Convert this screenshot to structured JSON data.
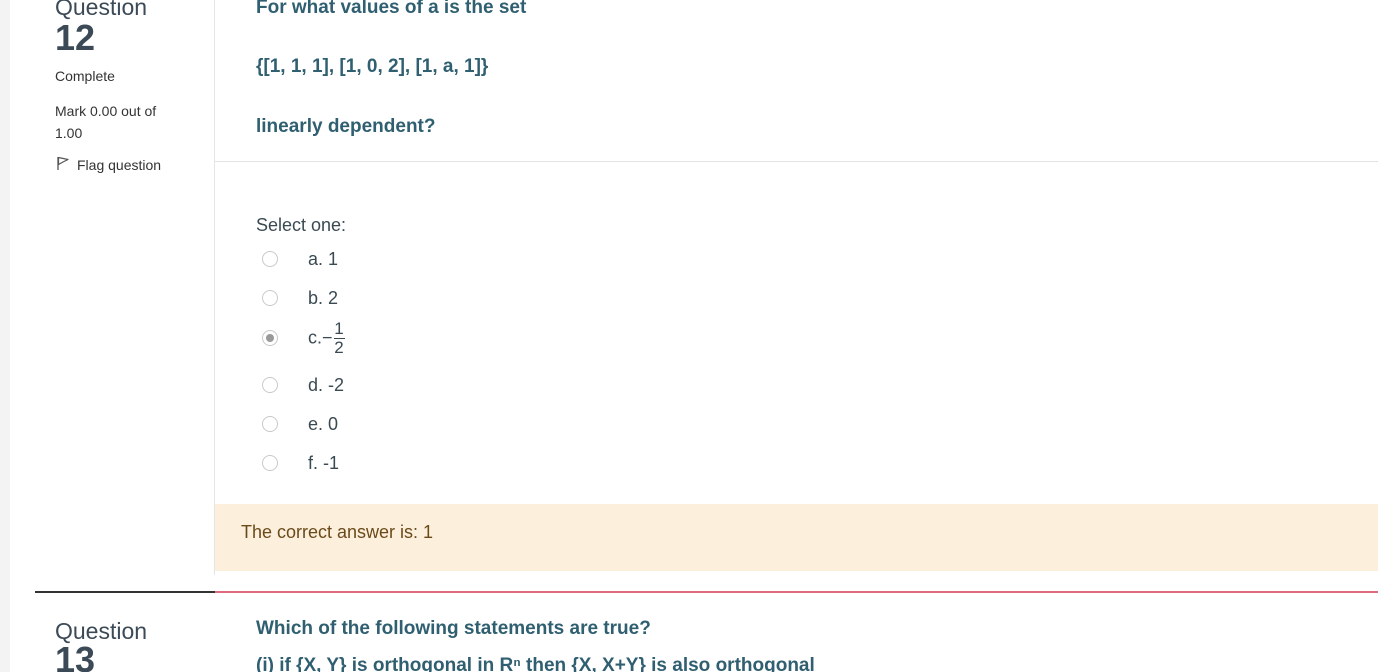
{
  "question12": {
    "label": "Question",
    "number": "12",
    "state": "Complete",
    "grade": "Mark 0.00 out of 1.00",
    "flag_label": "Flag question",
    "text_line1": "For what values of a is the set",
    "text_set": "{[1, 1, 1], [1, 0, 2], [1, a, 1]}",
    "text_line2": "linearly dependent?",
    "prompt": "Select one:",
    "options": [
      {
        "letter": "a.",
        "value": "1",
        "checked": false
      },
      {
        "letter": "b.",
        "value": "2",
        "checked": false
      },
      {
        "letter": "c.",
        "value": "−",
        "numerator": "1",
        "denominator": "2",
        "checked": true
      },
      {
        "letter": "d.",
        "value": "-2",
        "checked": false
      },
      {
        "letter": "e.",
        "value": "0",
        "checked": false
      },
      {
        "letter": "f.",
        "value": "-1",
        "checked": false
      }
    ],
    "feedback": "The correct answer is: 1"
  },
  "question13": {
    "label": "Question",
    "number": "13",
    "text_line1": "Which of the following statements are true?",
    "text_line2": "(i) if {X, Y} is orthogonal in Rⁿ then {X, X+Y} is also orthogonal"
  },
  "colors": {
    "question_text": "#2f5f70",
    "feedback_bg": "#fcefdc",
    "feedback_text": "#6b4a1a",
    "divider_red": "#e06b7c"
  },
  "icons": {
    "flag": "flag-icon",
    "radio": "radio-icon"
  }
}
